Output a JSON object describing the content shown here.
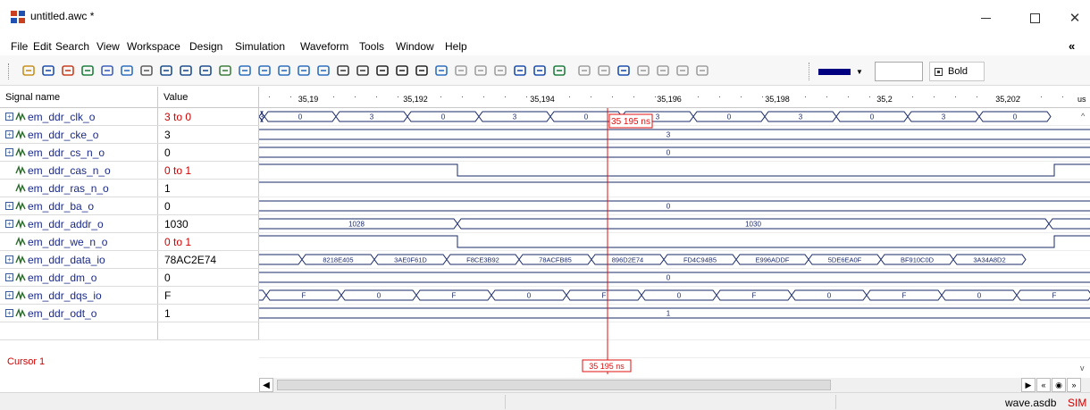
{
  "window": {
    "title": "untitled.awc *",
    "collapse_glyph": "«"
  },
  "menu": [
    "File",
    "Edit",
    "Search",
    "View",
    "Workspace",
    "Design",
    "Simulation",
    "Waveform",
    "Tools",
    "Window",
    "Help"
  ],
  "toolbar": {
    "icons": [
      "open-icon",
      "save-icon",
      "clock-icon",
      "signal-add-icon",
      "pointer-icon",
      "zoom-icon",
      "measure-icon",
      "bus-icon",
      "bus-split-icon",
      "bus-merge-icon",
      "copy-icon",
      "zoom-in-icon",
      "zoom-out-icon",
      "zoom-fit-icon",
      "zoom-range-icon",
      "zoom-cursor-icon",
      "prev-edge-icon",
      "next-edge-icon",
      "find-icon",
      "find-next-icon",
      "marker-icon",
      "edge-rising-icon",
      "edge-falling-icon",
      "edge-any-icon",
      "edge-both-icon",
      "db-icon",
      "hex-icon",
      "radix-icon",
      "analog-icon",
      "export-icon",
      "compare-icon",
      "print-icon",
      "annotate-icon",
      "delete-icon",
      "delete-all-icon"
    ],
    "color_value": "#000080",
    "size_value": "",
    "bold_label": "Bold"
  },
  "columns": {
    "name": "Signal name",
    "value": "Value"
  },
  "time_ticks": [
    "35,19",
    "35,192",
    "35,194",
    "35,196",
    "35,198",
    "35,2",
    "35,202",
    "us"
  ],
  "signals": [
    {
      "name": "em_ddr_clk_o",
      "value": "3 to 0",
      "highlight": true,
      "expandable": true
    },
    {
      "name": "em_ddr_cke_o",
      "value": "3",
      "highlight": false,
      "expandable": true
    },
    {
      "name": "em_ddr_cs_n_o",
      "value": "0",
      "highlight": false,
      "expandable": true
    },
    {
      "name": "em_ddr_cas_n_o",
      "value": "0 to 1",
      "highlight": true,
      "expandable": false
    },
    {
      "name": "em_ddr_ras_n_o",
      "value": "1",
      "highlight": false,
      "expandable": false
    },
    {
      "name": "em_ddr_ba_o",
      "value": "0",
      "highlight": false,
      "expandable": true
    },
    {
      "name": "em_ddr_addr_o",
      "value": "1030",
      "highlight": false,
      "expandable": true
    },
    {
      "name": "em_ddr_we_n_o",
      "value": "0 to 1",
      "highlight": true,
      "expandable": false
    },
    {
      "name": "em_ddr_data_io",
      "value": "78AC2E74",
      "highlight": false,
      "expandable": true
    },
    {
      "name": "em_ddr_dm_o",
      "value": "0",
      "highlight": false,
      "expandable": true
    },
    {
      "name": "em_ddr_dqs_io",
      "value": "F",
      "highlight": false,
      "expandable": true
    },
    {
      "name": "em_ddr_odt_o",
      "value": "1",
      "highlight": false,
      "expandable": true
    }
  ],
  "cursor": {
    "label": "Cursor 1",
    "time_label": "35 195 ns"
  },
  "waves": {
    "clk_labels": [
      "3",
      "0",
      "3",
      "0",
      "3",
      "0",
      "3",
      "0",
      "3",
      "0",
      "3",
      "0"
    ],
    "cke_label": "3",
    "cs_label": "0",
    "ba_label": "0",
    "addr_labels": [
      "1028",
      "1030"
    ],
    "data_labels": [
      "8218E405",
      "3AE0F61D",
      "F8CE3B92",
      "78ACFB85",
      "896D2E74",
      "FD4C94B5",
      "E996ADDF",
      "5DE6EA0F",
      "BF910C0D",
      "3A34A8D2"
    ],
    "dm_label": "0",
    "dqs_labels": [
      "F",
      "0",
      "F",
      "0",
      "F",
      "0",
      "F",
      "0",
      "F",
      "0",
      "F"
    ],
    "odt_label": "1"
  },
  "status": {
    "file": "wave.asdb",
    "mode": "SIM"
  },
  "colors": {
    "signal_text": "#1a2a8a",
    "wave": "#1a2a6a",
    "cursor": "#e01010"
  }
}
